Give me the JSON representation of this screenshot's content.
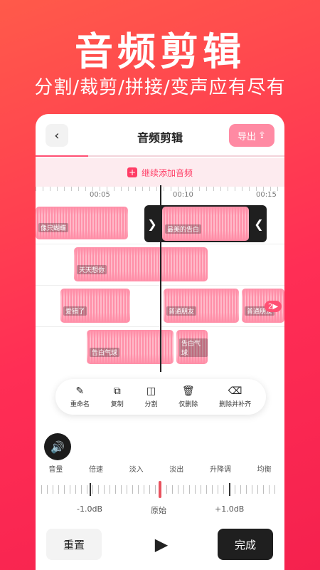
{
  "hero": {
    "title": "音频剪辑",
    "subtitle": "分割/裁剪/拼接/变声应有尽有"
  },
  "header": {
    "back_icon": "chevron-left-icon",
    "title": "音频剪辑",
    "export_label": "导出",
    "export_icon": "share-icon"
  },
  "add_audio": {
    "label": "继续添加音频"
  },
  "ruler": {
    "times": [
      "00:05",
      "00:10",
      "00:15"
    ]
  },
  "clips": {
    "c1": "像只蝴蝶",
    "c2": "最美的告白",
    "c3": "天天想你",
    "c4": "爱错了",
    "c5": "普通朋友",
    "c6": "普通朋友",
    "c7": "告白气球",
    "c8": "告白气球"
  },
  "more_badge": "2",
  "actions": [
    {
      "label": "重命名",
      "icon": "pen-plus-icon"
    },
    {
      "label": "复制",
      "icon": "copy-icon"
    },
    {
      "label": "分割",
      "icon": "split-icon"
    },
    {
      "label": "仅删除",
      "icon": "trash-icon"
    },
    {
      "label": "删除并补齐",
      "icon": "backspace-icon"
    }
  ],
  "effects": [
    "音量",
    "倍速",
    "淡入",
    "淡出",
    "升降调",
    "均衡"
  ],
  "volume_slider": {
    "min_label": "-1.0dB",
    "center_label": "原始",
    "max_label": "+1.0dB",
    "value": 0.5
  },
  "bottom": {
    "reset_label": "重置",
    "done_label": "完成"
  },
  "colors": {
    "accent": "#ff3d66",
    "clip": "#ff8fa8",
    "dark": "#1f1f1f"
  }
}
